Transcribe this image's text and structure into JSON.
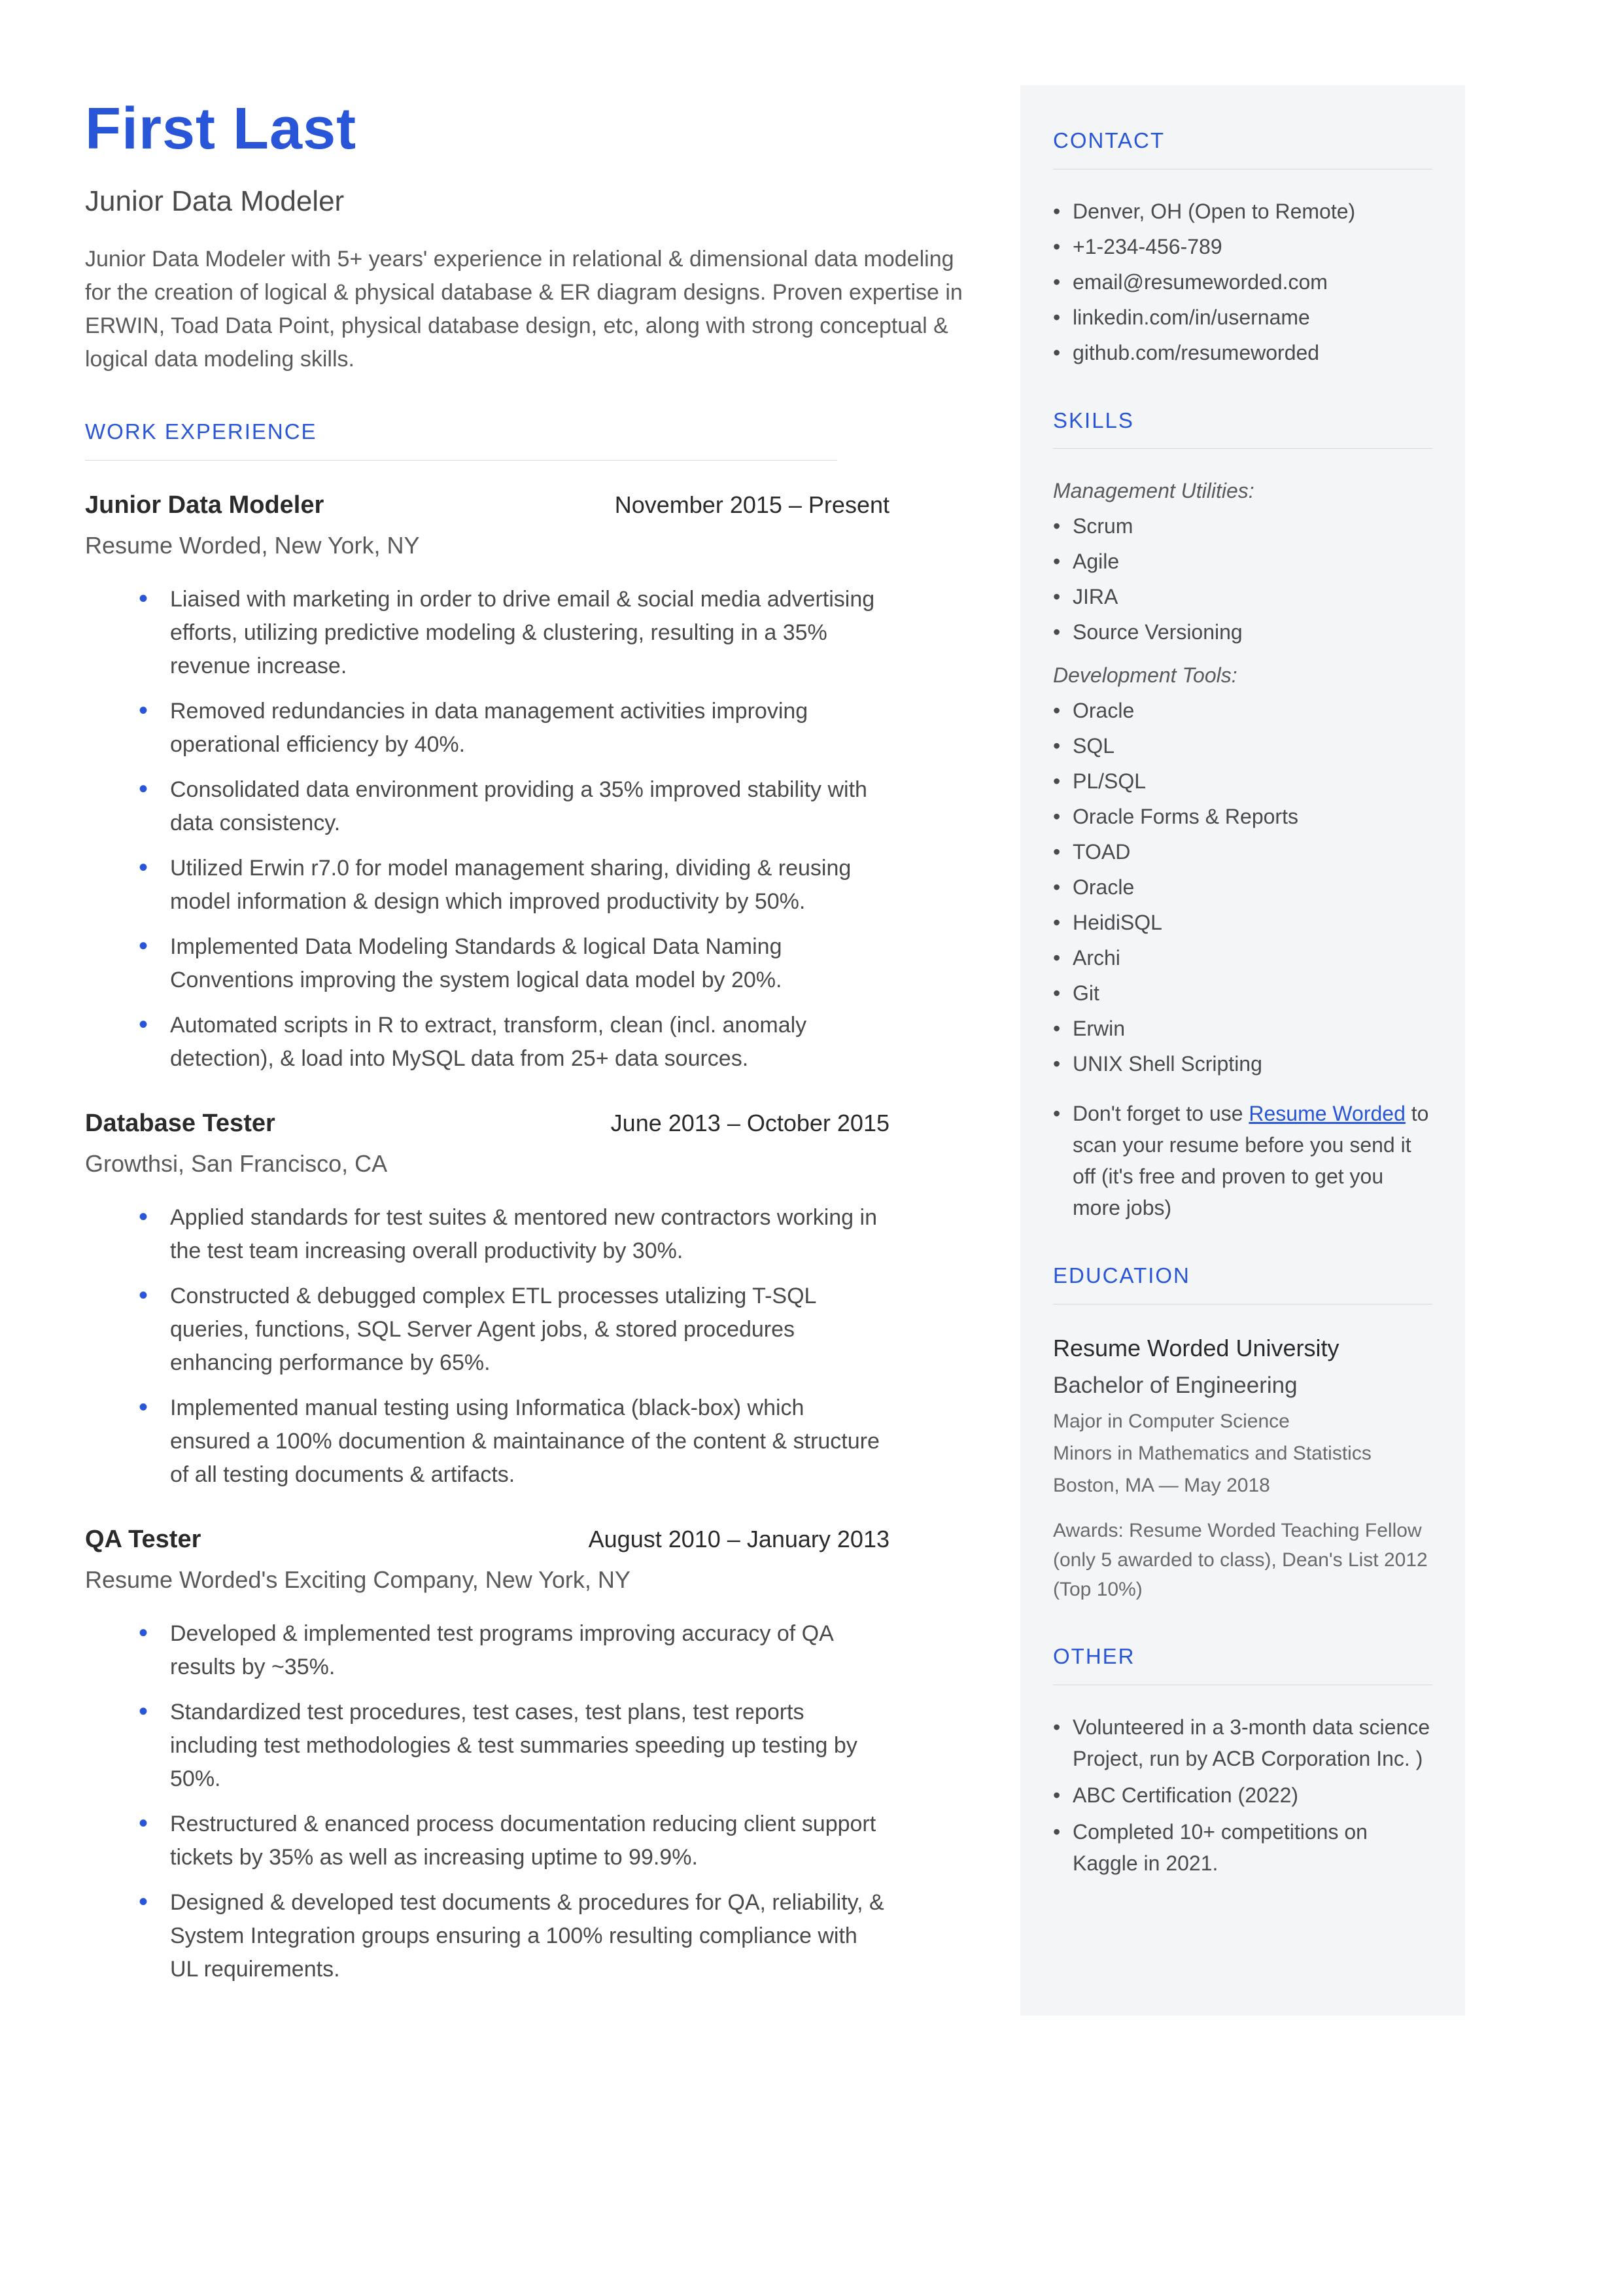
{
  "header": {
    "name": "First Last",
    "title": "Junior Data Modeler",
    "summary": "Junior Data Modeler with 5+ years' experience in relational & dimensional data modeling for the creation of logical & physical database & ER diagram designs. Proven expertise in ERWIN, Toad Data Point, physical database design, etc, along with strong conceptual & logical data modeling skills."
  },
  "sections": {
    "work": "WORK EXPERIENCE",
    "contact": "CONTACT",
    "skills": "SKILLS",
    "education": "EDUCATION",
    "other": "OTHER"
  },
  "jobs": [
    {
      "title": "Junior Data Modeler",
      "date": "November 2015 – Present",
      "company": "Resume Worded, New York, NY",
      "bullets": [
        "Liaised with marketing in order to drive email & social media advertising efforts, utilizing predictive modeling & clustering, resulting in a 35% revenue increase.",
        "Removed redundancies in data management activities improving operational efficiency by 40%.",
        "Consolidated data environment providing a 35% improved stability with data consistency.",
        "Utilized Erwin r7.0 for model management sharing, dividing & reusing model information & design which improved productivity by 50%.",
        "Implemented Data Modeling Standards & logical Data Naming Conventions improving the system logical data model by 20%.",
        "Automated scripts in R to extract, transform, clean (incl. anomaly detection), & load into MySQL data from 25+ data sources."
      ]
    },
    {
      "title": "Database Tester",
      "date": "June 2013 – October 2015",
      "company": "Growthsi, San Francisco, CA",
      "bullets": [
        "Applied standards for test suites & mentored new contractors working in the test team increasing overall productivity by 30%.",
        "Constructed & debugged complex ETL processes utalizing T-SQL queries, functions, SQL Server Agent jobs, & stored procedures enhancing performance by 65%.",
        "Implemented manual testing using Informatica (black-box) which ensured a 100% documention & maintainance of the content & structure of all testing documents & artifacts."
      ]
    },
    {
      "title": "QA Tester",
      "date": "August 2010 – January 2013",
      "company": "Resume Worded's Exciting Company, New York, NY",
      "bullets": [
        "Developed & implemented test programs improving accuracy of QA results by ~35%.",
        "Standardized test procedures, test cases, test plans, test reports including test methodologies & test summaries speeding up testing by 50%.",
        "Restructured & enanced process documentation reducing client support tickets by 35% as well as increasing uptime to 99.9%.",
        "Designed & developed test documents & procedures for QA, reliability, & System Integration groups ensuring a 100% resulting compliance with UL requirements."
      ]
    }
  ],
  "contact": [
    "Denver, OH (Open to Remote)",
    "+1-234-456-789",
    "email@resumeworded.com",
    "linkedin.com/in/username",
    "github.com/resumeworded"
  ],
  "skills": {
    "group1_label": "Management Utilities:",
    "group1": [
      "Scrum",
      "Agile",
      "JIRA",
      "Source Versioning"
    ],
    "group2_label": "Development Tools:",
    "group2": [
      "Oracle",
      "SQL",
      "PL/SQL",
      "Oracle Forms & Reports",
      "TOAD",
      "Oracle",
      "HeidiSQL",
      "Archi",
      "Git",
      "Erwin",
      "UNIX Shell Scripting"
    ],
    "note_pre": "Don't forget to use ",
    "note_link": "Resume Worded",
    "note_post": " to scan your resume before you send it off (it's free and proven to get you more jobs)"
  },
  "education": {
    "school": "Resume Worded University",
    "degree": "Bachelor of Engineering",
    "major": "Major in Computer Science",
    "minors": "Minors in Mathematics and Statistics",
    "loc": "Boston, MA — May 2018",
    "awards": "Awards: Resume Worded Teaching Fellow (only 5 awarded to class), Dean's List 2012 (Top 10%)"
  },
  "other": [
    "Volunteered in a 3-month data science Project, run by ACB Corporation Inc. )",
    "ABC Certification (2022)",
    "Completed 10+ competitions on Kaggle in 2021."
  ]
}
